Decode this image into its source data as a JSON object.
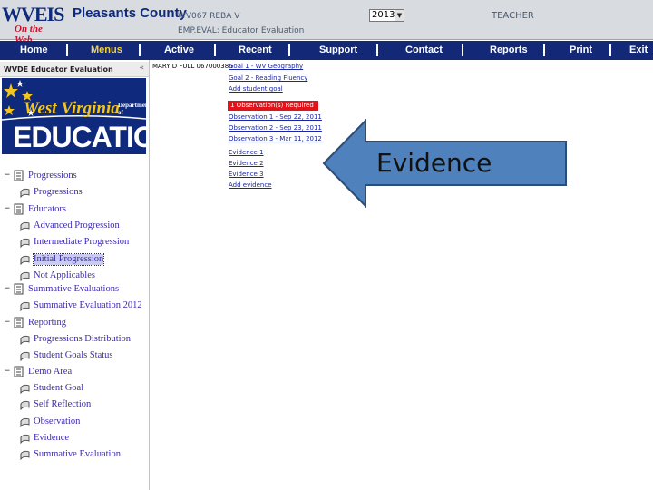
{
  "header": {
    "logo_text": "WVEIS",
    "logo_sub": "On the Web",
    "county": "Pleasants County",
    "code_line": "WV067 REBA V",
    "emp_line": "EMP.EVAL: Educator Evaluation",
    "year": "2013",
    "role": "TEACHER"
  },
  "nav": {
    "items": [
      "Home",
      "Menus",
      "Active",
      "Recent",
      "Support",
      "Contact",
      "Reports",
      "Print",
      "Exit"
    ],
    "active": "Menus"
  },
  "sidebar": {
    "title": "WVDE Educator Evaluation",
    "collapse_glyph": "«",
    "banner": {
      "state": "West Virginia",
      "dept": "Department of",
      "edu": "EDUCATION"
    },
    "tree": [
      {
        "label": "Progressions",
        "children": [
          {
            "label": "Progressions"
          }
        ]
      },
      {
        "label": "Educators",
        "children": [
          {
            "label": "Advanced Progression"
          },
          {
            "label": "Intermediate Progression"
          },
          {
            "label": "Initial Progression",
            "selected": true
          },
          {
            "label": "Not Applicables"
          }
        ]
      },
      {
        "label": "Summative Evaluations",
        "children": [
          {
            "label": "Summative Evaluation 2012"
          }
        ]
      },
      {
        "label": "Reporting",
        "children": [
          {
            "label": "Progressions Distribution"
          },
          {
            "label": "Student Goals Status"
          }
        ]
      },
      {
        "label": "Demo Area",
        "children": [
          {
            "label": "Student Goal"
          },
          {
            "label": "Self Reflection"
          },
          {
            "label": "Observation"
          },
          {
            "label": "Evidence"
          },
          {
            "label": "Summative Evaluation"
          }
        ]
      }
    ]
  },
  "main": {
    "employee": "MARY D FULL 067000386",
    "goal1": "Goal 1 - WV Geography",
    "goal2": "Goal 2 - Reading Fluency",
    "add_goal": "Add student goal",
    "obs_required": "1 Observation(s) Required",
    "obs1": "Observation 1 - Sep 22, 2011",
    "obs2": "Observation 2 - Sep 23, 2011",
    "obs3": "Observation 3 - Mar 11, 2012",
    "ev1": "Evidence 1",
    "ev2": "Evidence 2",
    "ev3": "Evidence 3",
    "add_ev": "Add evidence"
  },
  "callout": {
    "text": "Evidence",
    "fill_color": "#4f81bd",
    "border_color": "#2c4d75"
  },
  "colors": {
    "nav_bg": "#132978",
    "nav_active": "#f3d23b",
    "tree_link": "#3b2ab0",
    "main_link": "#1a25a3",
    "alert_red": "#e0141b"
  },
  "icons": {
    "tree_expanded": "minus-toggle",
    "tree_folder": "book-icon",
    "tree_leaf": "page-icon",
    "year_dropdown": "chevron-down-icon"
  }
}
